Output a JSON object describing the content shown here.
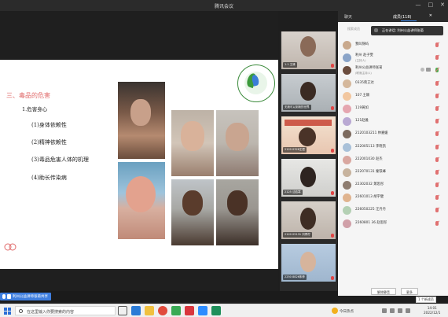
{
  "window": {
    "title": "腾讯会议",
    "controls": [
      "—",
      "□",
      "✕"
    ]
  },
  "slide": {
    "heading": "三、毒品的危害",
    "sub": "1.危害身心",
    "points": [
      "(1)身体依赖性",
      "(2)精神依赖性",
      "(3)毒品危害人体的机理",
      "(4)助长传染病"
    ],
    "logo_icon": "circular-green-logo"
  },
  "videos": [
    {
      "name": "1.1 王清"
    },
    {
      "name": "无我可以到我的世界"
    },
    {
      "name": "2120 0326王君"
    },
    {
      "name": "2125 沈若寒"
    },
    {
      "name": "2120 05131 刘青柠"
    },
    {
      "name": "2250 8826朱菲"
    }
  ],
  "panel": {
    "tabs": [
      {
        "label": "聊天"
      },
      {
        "label": "成员(118)"
      }
    ],
    "search_placeholder": "搜索成员",
    "speaking": "正在讲话: 利州公益讲师张菊",
    "participants": [
      {
        "name": "我叫锦屿",
        "role": ""
      },
      {
        "name": "利州 赵子雯",
        "role": "(主持人)"
      },
      {
        "name": "利州公益讲师张菊",
        "role": "(联席主持人)"
      },
      {
        "name": "0335蒋芷达",
        "role": ""
      },
      {
        "name": "107.王颖",
        "role": ""
      },
      {
        "name": "119黄如",
        "role": ""
      },
      {
        "name": "121赵雅",
        "role": ""
      },
      {
        "name": "2120103211 林嘉媛",
        "role": ""
      },
      {
        "name": "222005113 李晓凯",
        "role": ""
      },
      {
        "name": "222001030 赵杰",
        "role": ""
      },
      {
        "name": "222070131 秦铁峰",
        "role": ""
      },
      {
        "name": "22302032 萧思彤",
        "role": ""
      },
      {
        "name": "22601013 胡宇健",
        "role": ""
      },
      {
        "name": "226050225 汪丹丹",
        "role": ""
      },
      {
        "name": "2260801 36 赵思彤",
        "role": ""
      }
    ],
    "buttons": {
      "unmute_all": "解除静音",
      "more": "更多"
    }
  },
  "bottom": {
    "share_label": "利州公益讲师张菊共享",
    "notification": "1 个新成员"
  },
  "taskbar": {
    "search_placeholder": "在这里输入你要搜索的内容",
    "weather": "今日热点",
    "time": "14:01",
    "date": "2022/12/1"
  },
  "colors": {
    "accent": "#3b8af0",
    "mute": "#e07070",
    "heading": "#e06a6a"
  }
}
